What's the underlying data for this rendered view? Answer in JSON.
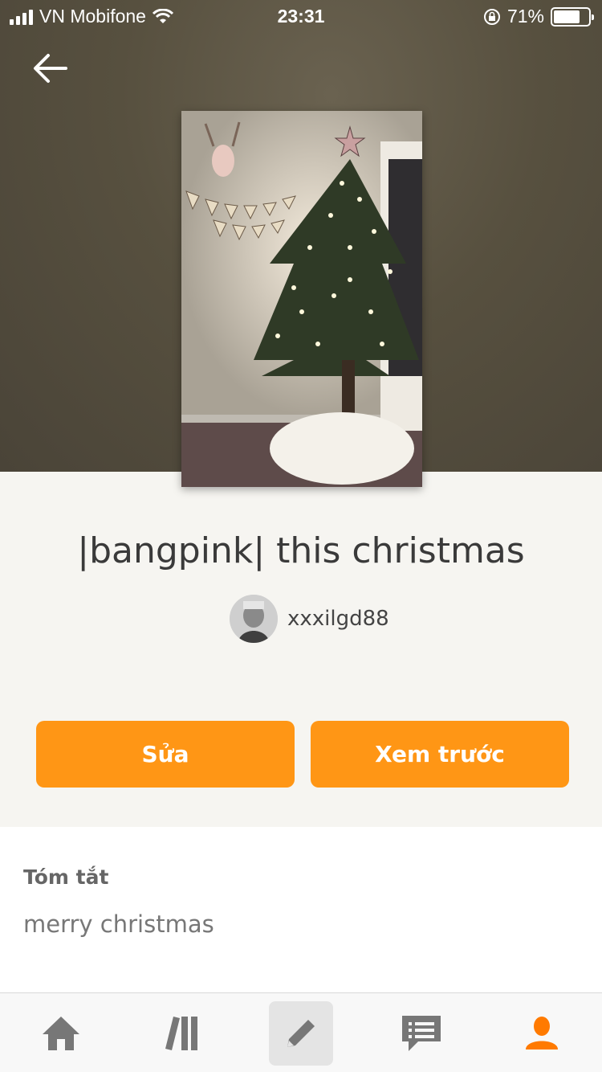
{
  "status_bar": {
    "carrier": "VN Mobifone",
    "time": "23:31",
    "battery": "71%"
  },
  "story": {
    "title": "|bangpink| this christmas",
    "author": "xxxilgd88"
  },
  "actions": {
    "edit_label": "Sửa",
    "preview_label": "Xem trước"
  },
  "summary": {
    "label": "Tóm tắt",
    "text": "merry christmas"
  },
  "tab_bar": {
    "active_color": "#ff7a00",
    "inactive_color": "#777777",
    "items": [
      "home-icon",
      "library-icon",
      "write-icon",
      "messages-icon",
      "profile-icon"
    ],
    "selected": "profile"
  },
  "colors": {
    "accent": "#ff9615"
  }
}
